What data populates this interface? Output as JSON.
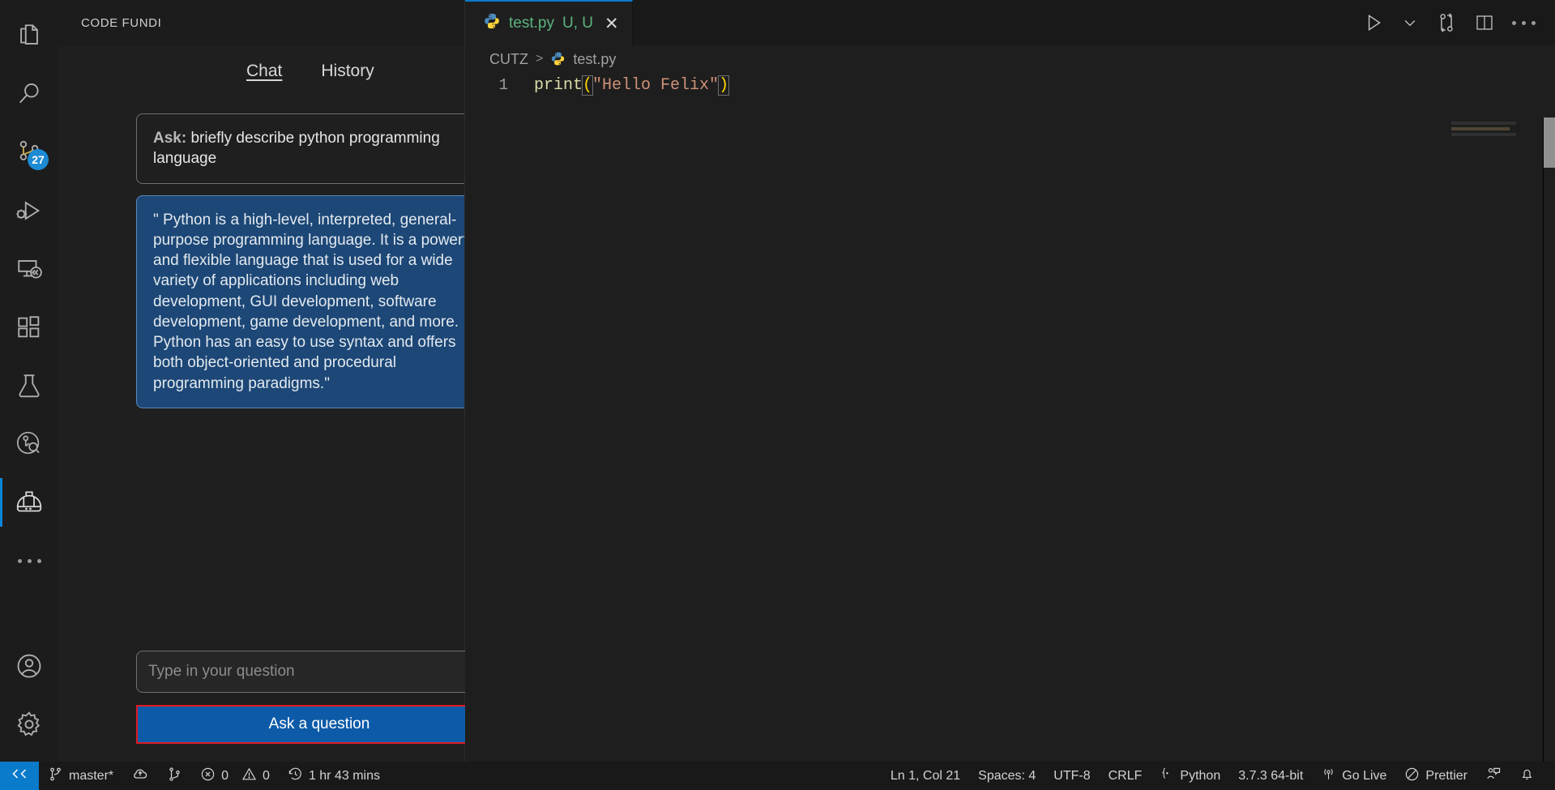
{
  "activity_bar": {
    "items": [
      {
        "name": "explorer",
        "icon": "files-icon",
        "badge": null
      },
      {
        "name": "search",
        "icon": "search-icon",
        "badge": null
      },
      {
        "name": "source-control",
        "icon": "source-control-icon",
        "badge": "27"
      },
      {
        "name": "run-and-debug",
        "icon": "run-debug-icon",
        "badge": null
      },
      {
        "name": "remote-explorer",
        "icon": "remote-explorer-icon",
        "badge": null
      },
      {
        "name": "extensions",
        "icon": "extensions-icon",
        "badge": null
      },
      {
        "name": "testing",
        "icon": "flask-icon",
        "badge": null
      },
      {
        "name": "code-inspector",
        "icon": "magnifier-circle-icon",
        "badge": null
      },
      {
        "name": "code-fundi",
        "icon": "hard-hat-icon",
        "badge": null,
        "active": true
      },
      {
        "name": "more-views",
        "icon": "ellipsis-icon",
        "badge": null
      }
    ],
    "bottom_items": [
      {
        "name": "accounts",
        "icon": "account-icon"
      },
      {
        "name": "manage-settings",
        "icon": "gear-icon"
      }
    ]
  },
  "sidebar": {
    "title": "CODE FUNDI",
    "tabs": [
      {
        "label": "Chat",
        "active": true
      },
      {
        "label": "History",
        "active": false
      }
    ],
    "chat": {
      "ask_label": "Ask:",
      "ask_text": "briefly describe python programming language",
      "answer_text": "\" Python is a high-level, interpreted, general-purpose programming language. It is a powerful and flexible language that is used for a wide variety of applications including web development, GUI development, software development, game development, and more. Python has an easy to use syntax and offers both object-oriented and procedural programming paradigms.\""
    },
    "input_placeholder": "Type in your question",
    "input_value": "",
    "ask_button_label": "Ask a question",
    "accent_colors": {
      "answer_bubble_bg": "#1c4776",
      "answer_bubble_border": "#5b87bb",
      "button_bg": "#0d5ba8",
      "button_border": "#e01b24"
    }
  },
  "editor": {
    "tab": {
      "filename": "test.py",
      "flags": "U, U",
      "icon": "python-icon",
      "close_icon": "close-icon"
    },
    "toolbar": [
      {
        "name": "run-python-file",
        "icon": "play-icon"
      },
      {
        "name": "run-options",
        "icon": "chevron-down-icon"
      },
      {
        "name": "source-control-compare",
        "icon": "compare-changes-icon"
      },
      {
        "name": "split-editor",
        "icon": "split-editor-icon"
      },
      {
        "name": "more-actions",
        "icon": "ellipsis-icon"
      }
    ],
    "breadcrumb": {
      "root": "CUTZ",
      "separator": ">",
      "file": "test.py",
      "file_icon": "python-icon"
    },
    "code": {
      "line_number": "1",
      "tokens": {
        "fn": "print",
        "open_paren": "(",
        "string": "\"Hello Felix\"",
        "close_paren": ")"
      }
    }
  },
  "status_bar": {
    "remote_icon": "remote-window-icon",
    "left": [
      {
        "name": "git-branch",
        "icon": "branch-icon",
        "label": "master*"
      },
      {
        "name": "sync-changes",
        "icon": "cloud-sync-icon",
        "label": ""
      },
      {
        "name": "git-graph",
        "icon": "git-graph-icon",
        "label": ""
      },
      {
        "name": "errors",
        "icon": "error-icon",
        "label": "0"
      },
      {
        "name": "warnings",
        "icon": "warning-icon",
        "label": "0"
      },
      {
        "name": "wakatime",
        "icon": "clock-icon",
        "label": "1 hr 43 mins"
      }
    ],
    "right": [
      {
        "name": "cursor-position",
        "icon": "",
        "label": "Ln 1, Col 21"
      },
      {
        "name": "indentation",
        "icon": "",
        "label": "Spaces: 4"
      },
      {
        "name": "encoding",
        "icon": "",
        "label": "UTF-8"
      },
      {
        "name": "line-endings",
        "icon": "",
        "label": "CRLF"
      },
      {
        "name": "language-mode",
        "icon": "braces-icon",
        "label": "Python"
      },
      {
        "name": "python-interpreter",
        "icon": "",
        "label": "3.7.3 64-bit"
      },
      {
        "name": "go-live",
        "icon": "broadcast-icon",
        "label": "Go Live"
      },
      {
        "name": "prettier",
        "icon": "prettier-icon",
        "label": "Prettier"
      },
      {
        "name": "feedback",
        "icon": "feedback-icon",
        "label": ""
      },
      {
        "name": "notifications",
        "icon": "bell-icon",
        "label": ""
      }
    ]
  }
}
